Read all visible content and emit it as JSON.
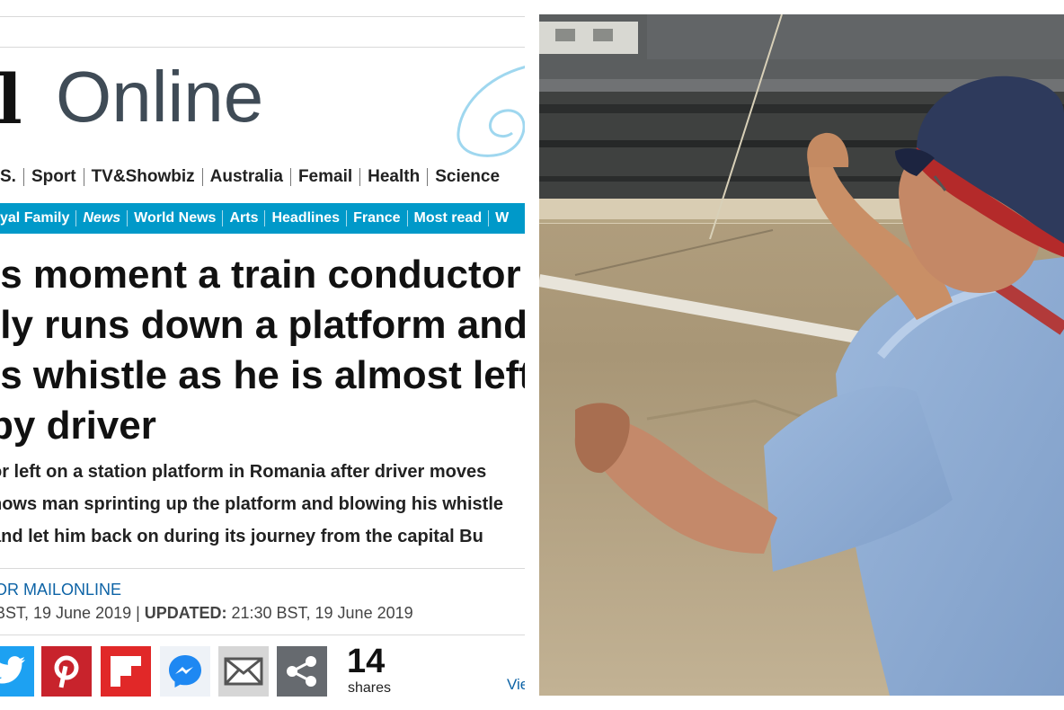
{
  "logo": {
    "mark": "il",
    "online": "Online"
  },
  "nav_primary": [
    "S.",
    "Sport",
    "TV&Showbiz",
    "Australia",
    "Femail",
    "Health",
    "Science"
  ],
  "nav_secondary": [
    "yal Family",
    "News",
    "World News",
    "Arts",
    "Headlines",
    "France",
    "Most read",
    "W"
  ],
  "nav_secondary_current": "News",
  "headline_lines": [
    "is moment a train conductor",
    "lly runs down a platform and",
    "is whistle as he is almost left",
    "by driver"
  ],
  "bullets": [
    "or left on a station platform in Romania after driver moves",
    "hows man sprinting up the platform and blowing his whistle",
    "and let him back on during its journey from the capital Bu"
  ],
  "byline": "OR MAILONLINE",
  "dates": {
    "published": "BST, 19 June 2019 | ",
    "updated_label": "UPDATED:",
    "updated": " 21:30 BST, 19 June 2019"
  },
  "share": {
    "count": "14",
    "count_label": "shares",
    "view_link": "Vie",
    "buttons": [
      "twitter-icon",
      "pinterest-icon",
      "flipboard-icon",
      "messenger-icon",
      "email-icon",
      "share-icon"
    ]
  },
  "colors": {
    "nav_blue": "#0099c9",
    "link_blue": "#0d63a6",
    "logo_gray": "#3f4b56"
  }
}
